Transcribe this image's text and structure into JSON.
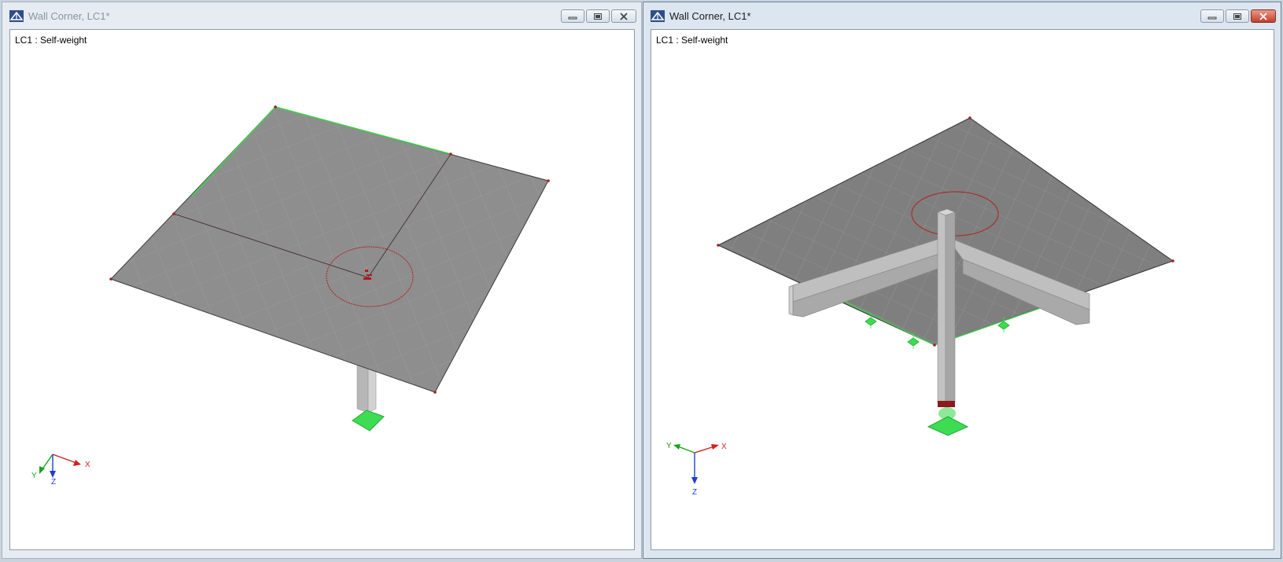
{
  "windows": [
    {
      "title": "Wall Corner, LC1*",
      "state": "inactive",
      "load_case_label": "LC1 : Self-weight",
      "axes": {
        "x": "X",
        "y": "Y",
        "z": "Z"
      }
    },
    {
      "title": "Wall Corner, LC1*",
      "state": "active",
      "load_case_label": "LC1 : Self-weight",
      "axes": {
        "x": "X",
        "y": "Y",
        "z": "Z"
      }
    }
  ],
  "colors": {
    "plate": "#8c8c8c",
    "mesh": "#a6a6a6",
    "support": "#37d94a",
    "section_line": "#b22222",
    "axis_x": "#d21f1f",
    "axis_y": "#1aa31a",
    "axis_z": "#1f3fd1",
    "column": "#bdbdbd"
  },
  "icons": [
    "app-icon",
    "minimize-icon",
    "restore-icon",
    "close-icon"
  ]
}
